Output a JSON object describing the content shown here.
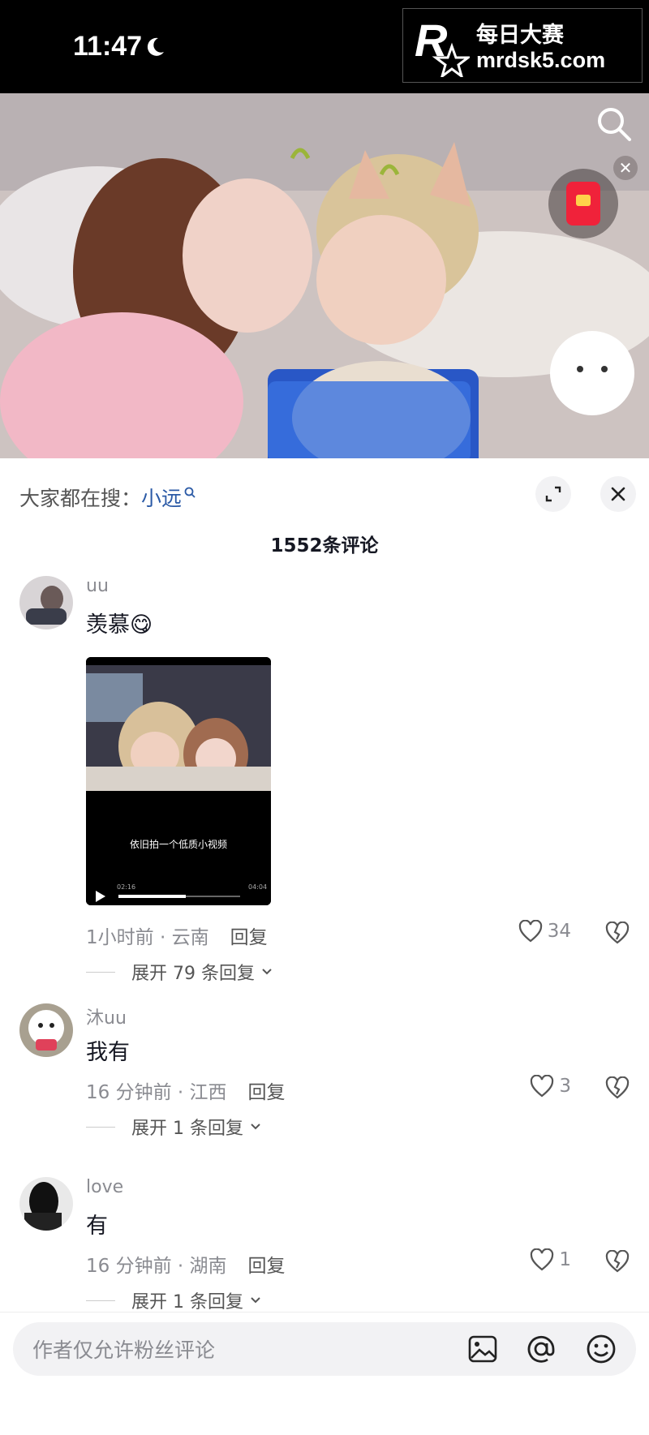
{
  "status_bar": {
    "time": "11:47"
  },
  "watermark": {
    "line1": "每日大赛",
    "line2": "mrdsk5.com",
    "logo_text": "R 每日大赛"
  },
  "comments_panel": {
    "suggestion_prefix": "大家都在搜：",
    "suggestion_keyword": "小远",
    "comment_count": "1552条评论"
  },
  "comments": [
    {
      "username": "uu",
      "text": "羡慕",
      "emoji": "😋",
      "time_location": "1小时前 · 云南",
      "reply_label": "回复",
      "likes": "34",
      "expand_label": "展开 79 条回复",
      "attachment": {
        "caption": "依旧拍一个低质小视频",
        "current_time": "02:16",
        "duration": "04:04",
        "progress": 0.55
      }
    },
    {
      "username": "沐uu",
      "text": "我有",
      "time_location": "16 分钟前 · 江西",
      "reply_label": "回复",
      "likes": "3",
      "expand_label": "展开 1 条回复"
    },
    {
      "username": "love",
      "text": "有",
      "time_location": "16 分钟前 · 湖南",
      "reply_label": "回复",
      "likes": "1",
      "expand_label": "展开 1 条回复"
    }
  ],
  "input": {
    "placeholder": "作者仅允许粉丝评论"
  },
  "icons": [
    "moon-icon",
    "search-icon",
    "close-icon",
    "red-packet-icon",
    "expand-icon",
    "heart-icon",
    "dislike-icon",
    "image-icon",
    "at-icon",
    "emoji-icon"
  ],
  "colors": {
    "accent_link": "#2b5aa6",
    "muted": "#8a8b91",
    "red_packet": "#f0223a"
  }
}
